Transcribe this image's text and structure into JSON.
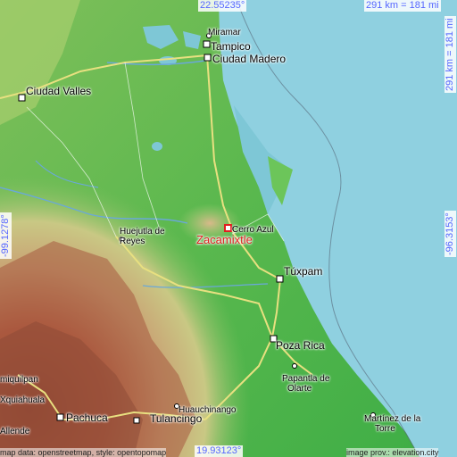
{
  "coordinates": {
    "lat_north": "22.55235°",
    "lat_south": "19.93123°",
    "lon_west": "-99.1278°",
    "lon_east": "-96.3153°",
    "scale_top": "291 km = 181 mi",
    "scale_right": "291 km = 181 mi"
  },
  "target": {
    "name": "Zacamixtle"
  },
  "places": {
    "miramar": "Miramar",
    "tampico": "Tampico",
    "ciudad_madero": "Ciudad Madero",
    "ciudad_valles": "Ciudad Valles",
    "cerro_azul": "Cerro Azul",
    "huejutla_1": "Huejutla de",
    "huejutla_2": "Reyes",
    "tuxpam": "Túxpam",
    "poza_rica": "Poza Rica",
    "papantla_1": "Papantla de",
    "papantla_2": "Olarte",
    "huauchinango": "Huauchinango",
    "martinez_1": "Martínez de la",
    "martinez_2": "Torre",
    "pachuca": "Pachuca",
    "tulancingo": "Tulancingo",
    "xquiahuala": "Xquiahuala",
    "miquilpan": "miquilpan",
    "allende": "Allende"
  },
  "credits": {
    "left": "map data: openstreetmap, style: opentopomap",
    "right": "image prov.: elevation.city"
  },
  "colors": {
    "sea": "#8fd0e0",
    "lowland": "#4fb04a",
    "highland": "#c8a070",
    "mountain": "#a0503a",
    "label_coord": "#5566ff",
    "target": "#e02020"
  }
}
